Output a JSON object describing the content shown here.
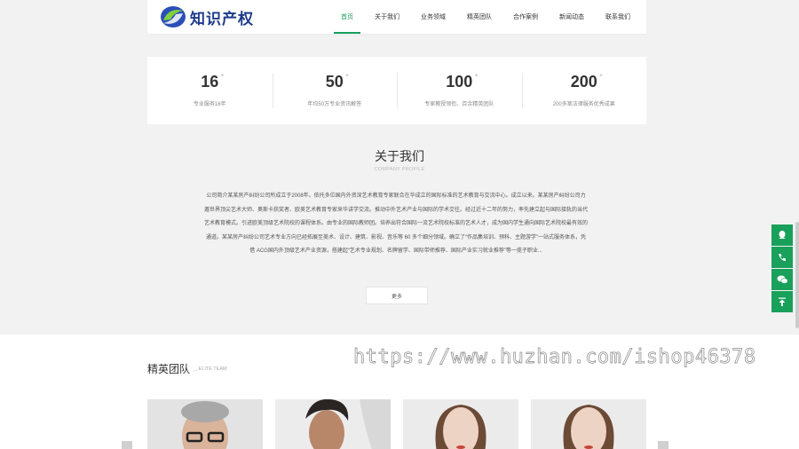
{
  "header": {
    "logo_text": "知识产权",
    "nav": [
      {
        "label": "首页",
        "active": true
      },
      {
        "label": "关于我们"
      },
      {
        "label": "业务领域"
      },
      {
        "label": "精英团队"
      },
      {
        "label": "合作案例"
      },
      {
        "label": "新闻动态"
      },
      {
        "label": "联系我们"
      }
    ]
  },
  "stats": [
    {
      "num": "16",
      "sup": "+",
      "desc": "专业服务16年"
    },
    {
      "num": "50",
      "sup": "+",
      "desc": "年均50万专业资讯解答"
    },
    {
      "num": "100",
      "sup": "+",
      "desc": "专家教授领衔、百余精英团队"
    },
    {
      "num": "200",
      "sup": "+",
      "desc": "200多案法律服务优秀成果"
    }
  ],
  "about": {
    "title": "关于我们",
    "subtitle": "COMPANY PROFILE",
    "text": "公司简介某某房产纠纷公司所成立于2008年。依托多位国内外资深艺术教育专家联合在华成立的国际标准的艺术教育与交流中心。成立以来。某某房产纠纷公司力邀世界顶尖艺术大师、奥斯卡获奖者、欧美艺术教育专家来华讲学交流。推动中外艺术产业与国际的学术交往。经过近十二年的努力，率先建立起与国际接轨的当代艺术教育模式。引进欧美顶级艺术院校的课程体系。由专业的国际教师团。培养出符合国际一流艺术院校标准的艺术人才，成为国内学生通向国际艺术院校最有效的通道。某某房产纠纷公司艺术专业方向已经拓展至美术、设计、建筑、影视、音乐等 60 多个细分领域。确立了“作品集培训、预科、主题游学”一站式服务体系，凭借 ACG国内外顶级艺术产业资源，搭建起“艺术专业规划、名牌留学、国际带师推荐、国际产业实习就业推荐”等一揽子职业...",
    "more_label": "更多"
  },
  "team": {
    "title": "精英团队",
    "subtitle": "ELITE TEAM"
  },
  "watermark": "https://www.huzhan.com/ishop46378",
  "side_tools": [
    "qq-icon",
    "phone-icon",
    "wechat-icon",
    "back-to-top-icon"
  ],
  "colors": {
    "accent": "#17a05d",
    "side": "#19a05a",
    "logo": "#1f3a8a"
  }
}
